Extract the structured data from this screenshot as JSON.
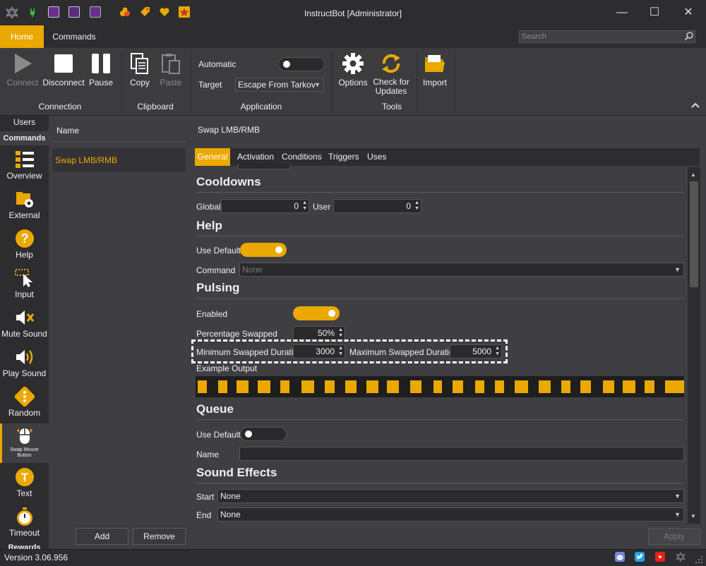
{
  "window": {
    "title": "InstructBot [Administrator]",
    "minimize": "—",
    "maximize": "☐",
    "close": "✕"
  },
  "ribbon_tabs": [
    "Home",
    "Commands"
  ],
  "search": {
    "placeholder": "Search"
  },
  "ribbon": {
    "connection": {
      "group": "Connection",
      "connect": "Connect",
      "disconnect": "Disconnect",
      "pause": "Pause"
    },
    "clipboard": {
      "group": "Clipboard",
      "copy": "Copy",
      "paste": "Paste"
    },
    "application": {
      "group": "Application",
      "automatic_label": "Automatic",
      "automatic_on": false,
      "target_label": "Target",
      "target_value": "Escape From Tarkov"
    },
    "tools": {
      "group": "Tools",
      "options": "Options",
      "check_updates_line1": "Check for",
      "check_updates_line2": "Updates"
    },
    "import": {
      "label": "Import"
    }
  },
  "nav": {
    "users": "Users",
    "commands_header": "Commands",
    "items": [
      "Overview",
      "External",
      "Help",
      "Input",
      "Mute Sound",
      "Play Sound",
      "Random",
      "Text",
      "Timeout"
    ],
    "swap_line1": "Swap Mouse",
    "swap_line2": "Button",
    "rewards_header": "Rewards"
  },
  "list": {
    "header": "Name",
    "items": [
      "Swap LMB/RMB"
    ],
    "add": "Add",
    "remove": "Remove"
  },
  "detail": {
    "title": "Swap LMB/RMB",
    "tabs": [
      "General",
      "Activation",
      "Conditions",
      "Triggers",
      "Uses"
    ],
    "cooldowns": {
      "heading": "Cooldowns",
      "global_label": "Global",
      "global_value": "0",
      "user_label": "User",
      "user_value": "0"
    },
    "help": {
      "heading": "Help",
      "use_default_label": "Use Default",
      "use_default_on": true,
      "command_label": "Command",
      "command_value": "None"
    },
    "pulsing": {
      "heading": "Pulsing",
      "enabled_label": "Enabled",
      "enabled_on": true,
      "percentage_label": "Percentage Swapped",
      "percentage_value": "50%",
      "min_label": "Minimum Swapped Duration",
      "min_value": "3000",
      "max_label": "Maximum Swapped Duration",
      "max_value": "5000",
      "example_label": "Example Output"
    },
    "queue": {
      "heading": "Queue",
      "use_default_label": "Use Default",
      "use_default_on": false,
      "name_label": "Name",
      "name_value": ""
    },
    "sound": {
      "heading": "Sound Effects",
      "start_label": "Start",
      "start_value": "None",
      "end_label": "End",
      "end_value": "None"
    },
    "apply": "Apply"
  },
  "status": {
    "version": "Version 3.06.956"
  },
  "colors": {
    "accent": "#eaa800",
    "background": "#3f3f43",
    "dark": "#2d2d30",
    "discord": "#7289da",
    "twitter": "#1da1f2",
    "youtube": "#e62117"
  }
}
